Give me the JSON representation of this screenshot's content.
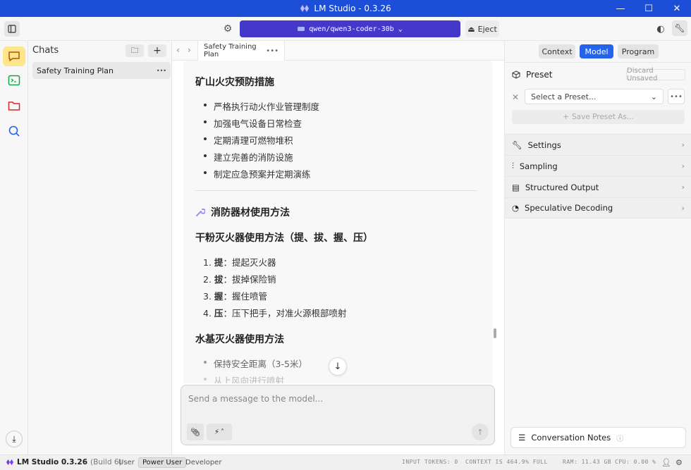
{
  "window": {
    "title": "LM Studio - 0.3.26",
    "min": "—",
    "max": "☐",
    "close": "✕"
  },
  "toolbar": {
    "model": "qwen/qwen3-coder-30b",
    "eject": "Eject"
  },
  "chats": {
    "header": "Chats",
    "items": [
      {
        "label": "Safety Training Plan",
        "more": "•••"
      }
    ]
  },
  "tab": {
    "label": "Safety Training Plan",
    "more": "•••"
  },
  "message": {
    "h_prevention": "矿山火灾预防措施",
    "prevention_items": [
      "严格执行动火作业管理制度",
      "加强电气设备日常检查",
      "定期清理可燃物堆积",
      "建立完善的消防设施",
      "制定应急预案并定期演练"
    ],
    "h_equipment": "消防器材使用方法",
    "h_dry": "干粉灭火器使用方法（提、拔、握、压）",
    "dry_steps": [
      {
        "num": "1.",
        "key": "提",
        "text": "：提起灭火器"
      },
      {
        "num": "2.",
        "key": "拔",
        "text": "：拔掉保险销"
      },
      {
        "num": "3.",
        "key": "握",
        "text": "：握住喷管"
      },
      {
        "num": "4.",
        "key": "压",
        "text": "：压下把手，对准火源根部喷射"
      }
    ],
    "h_water": "水基灭火器使用方法",
    "water_items": [
      "保持安全距离（3-5米）",
      "从上风向进行喷射"
    ]
  },
  "input": {
    "placeholder": "Send a message to the model..."
  },
  "right": {
    "tabs": [
      "Context",
      "Model",
      "Program"
    ],
    "active_tab": "Model",
    "preset_label": "Preset",
    "discard": "Discard Unsaved",
    "select_preset": "Select a Preset...",
    "save_preset": "Save Preset As...",
    "sections": [
      "Settings",
      "Sampling",
      "Structured Output",
      "Speculative Decoding"
    ],
    "conv_notes": "Conversation Notes"
  },
  "status": {
    "app": "LM Studio 0.3.26",
    "build": "(Build 6)",
    "modes": [
      "User",
      "Power User",
      "Developer"
    ],
    "active_mode": "Power User",
    "input_tokens": "INPUT TOKENS:  0",
    "context": "CONTEXT IS 464.9% FULL",
    "ram": "RAM: 11.43 GB",
    "cpu": "CPU: 0.00 %"
  },
  "colors": {
    "titlebar": "#1d4ed8",
    "model_picker": "#4338ca",
    "accent": "#2563eb",
    "active_rail": "#fde68a"
  },
  "icons": [
    "sidebar-toggle-icon",
    "gear-icon",
    "palette-icon",
    "wrench-icon",
    "chat-icon",
    "terminal-icon",
    "folder-icon",
    "search-icon",
    "download-icon",
    "paperclip-icon",
    "plug-icon",
    "send-icon",
    "arrow-down-icon"
  ]
}
